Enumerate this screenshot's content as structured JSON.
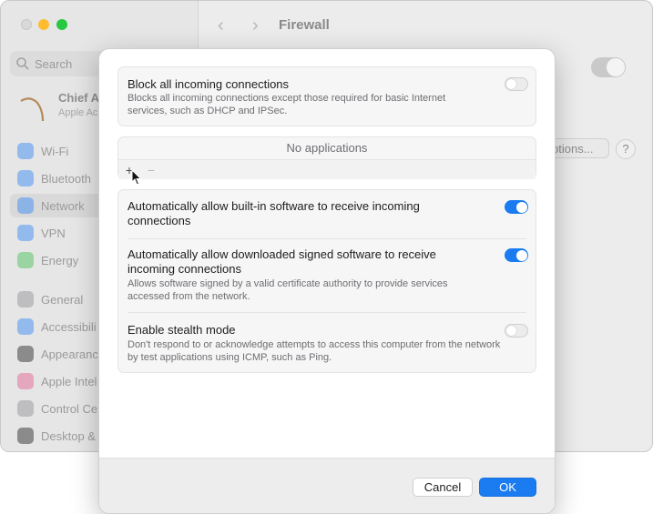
{
  "window": {
    "title": "Firewall",
    "search_placeholder": "Search",
    "account_name": "Chief A",
    "account_sub": "Apple Ac",
    "options_label": "ptions...",
    "help_label": "?",
    "sidebar_items": [
      {
        "label": "Wi-Fi",
        "color": "#2f86f6"
      },
      {
        "label": "Bluetooth",
        "color": "#2f86f6"
      },
      {
        "label": "Network",
        "color": "#2f86f6"
      },
      {
        "label": "VPN",
        "color": "#2f86f6"
      },
      {
        "label": "Energy",
        "color": "#3fbf4f"
      },
      {
        "label": "General",
        "color": "#8e8e93"
      },
      {
        "label": "Accessibili",
        "color": "#2f86f6"
      },
      {
        "label": "Appearanc",
        "color": "#1d1d1f"
      },
      {
        "label": "Apple Intel",
        "color": "#e25a8f"
      },
      {
        "label": "Control Ce",
        "color": "#8e8e93"
      },
      {
        "label": "Desktop &",
        "color": "#1d1d1f"
      }
    ],
    "selected_sidebar": "Network"
  },
  "sheet": {
    "block_all": {
      "title": "Block all incoming connections",
      "description": "Blocks all incoming connections except those required for basic Internet services, such as DHCP and IPSec.",
      "enabled": false
    },
    "apps": {
      "empty_label": "No applications",
      "add_label": "+",
      "remove_label": "−"
    },
    "builtin": {
      "title": "Automatically allow built-in software to receive incoming connections",
      "enabled": true
    },
    "signed": {
      "title": "Automatically allow downloaded signed software to receive incoming connections",
      "description": "Allows software signed by a valid certificate authority to provide services accessed from the network.",
      "enabled": true
    },
    "stealth": {
      "title": "Enable stealth mode",
      "description": "Don't respond to or acknowledge attempts to access this computer from the network by test applications using ICMP, such as Ping.",
      "enabled": false
    },
    "cancel_label": "Cancel",
    "ok_label": "OK",
    "accent_color": "#1a7cf0"
  }
}
